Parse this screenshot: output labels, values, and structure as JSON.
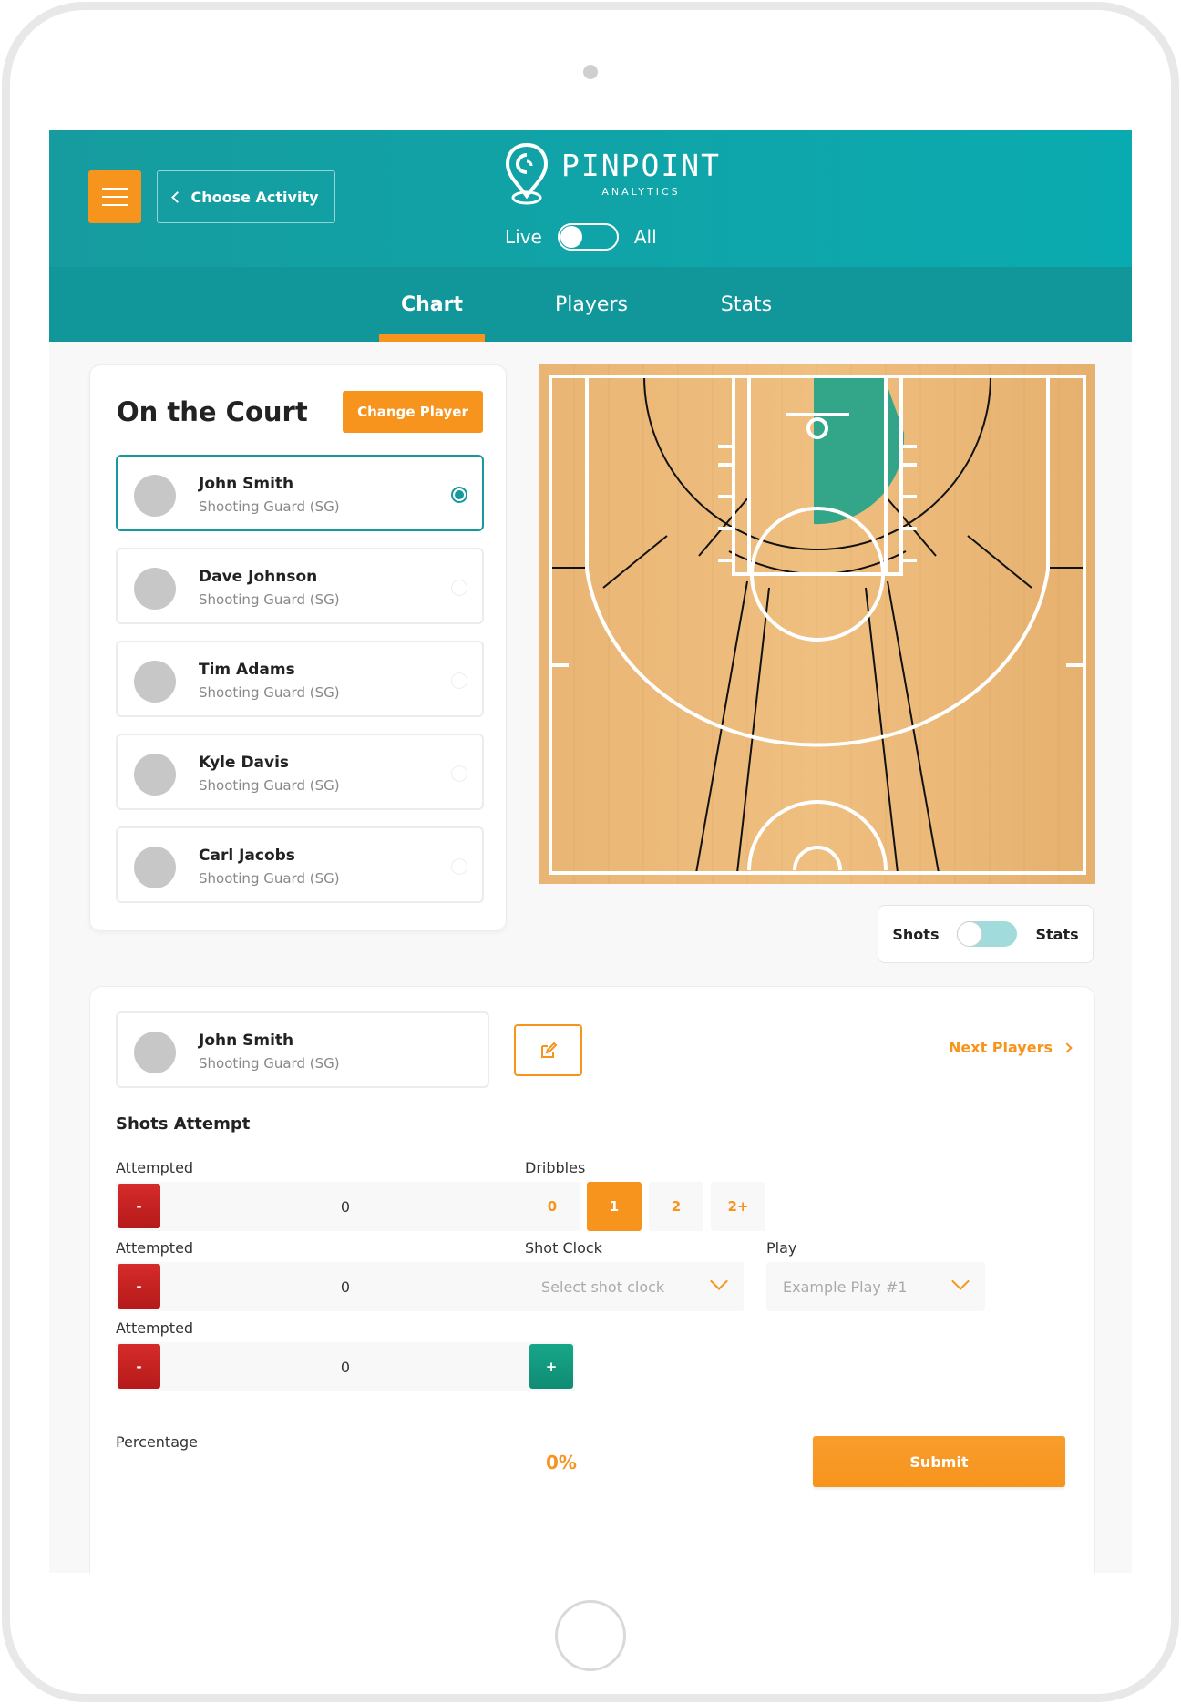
{
  "header": {
    "back_label": "Choose Activity",
    "logo_title": "PINPOINT",
    "logo_subtitle": "ANALYTICS",
    "toggle_left": "Live",
    "toggle_right": "All",
    "accent": "#f7941d",
    "brand": "#0aabb0"
  },
  "tabs": [
    {
      "label": "Chart",
      "active": true
    },
    {
      "label": "Players",
      "active": false
    },
    {
      "label": "Stats",
      "active": false
    }
  ],
  "on_court": {
    "title": "On the Court",
    "change_label": "Change Player",
    "players": [
      {
        "name": "John Smith",
        "role": "Shooting Guard (SG)",
        "selected": true
      },
      {
        "name": "Dave Johnson",
        "role": "Shooting Guard (SG)",
        "selected": false
      },
      {
        "name": "Tim Adams",
        "role": "Shooting Guard (SG)",
        "selected": false
      },
      {
        "name": "Kyle Davis",
        "role": "Shooting Guard (SG)",
        "selected": false
      },
      {
        "name": "Carl Jacobs",
        "role": "Shooting Guard (SG)",
        "selected": false
      }
    ]
  },
  "court_toggle": {
    "left": "Shots",
    "right": "Stats"
  },
  "panel": {
    "current_player": {
      "name": "John Smith",
      "role": "Shooting Guard (SG)"
    },
    "next_label": "Next Players",
    "section_title": "Shots Attempt",
    "steppers": [
      {
        "label": "Attempted",
        "value": "0",
        "minus": "-",
        "plus": "+"
      },
      {
        "label": "Attempted",
        "value": "0",
        "minus": "-",
        "plus": "+"
      },
      {
        "label": "Attempted",
        "value": "0",
        "minus": "-",
        "plus": "+"
      }
    ],
    "dribbles": {
      "label": "Dribbles",
      "options": [
        "0",
        "1",
        "2",
        "2+"
      ],
      "selected": "1"
    },
    "shot_clock": {
      "label": "Shot Clock",
      "placeholder": "Select shot clock"
    },
    "play": {
      "label": "Play",
      "placeholder": "Example Play #1"
    },
    "percentage_label": "Percentage",
    "percentage_value": "0%",
    "submit_label": "Submit"
  }
}
